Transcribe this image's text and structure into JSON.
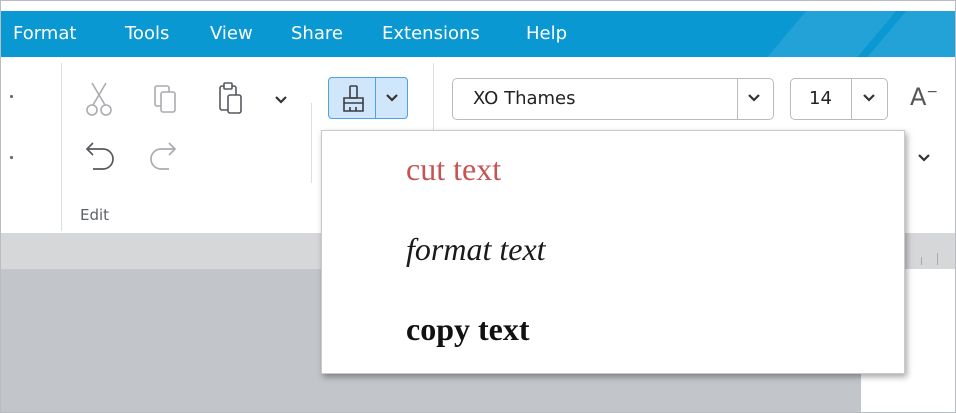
{
  "menubar": {
    "items": [
      "Format",
      "Tools",
      "View",
      "Share",
      "Extensions",
      "Help"
    ],
    "color": "#0a98d3"
  },
  "ribbon": {
    "edit_group_label": "Edit",
    "clone_formatting_active": true,
    "font_name": "XO Thames",
    "font_size": "14",
    "decrease_font_label": "A",
    "icons": [
      "cut-icon",
      "copy-icon",
      "paste-icon",
      "chevron-down-icon",
      "undo-icon",
      "redo-icon",
      "format-brush-icon"
    ]
  },
  "dropdown": {
    "items": [
      {
        "label": "cut text",
        "style": "regular",
        "color": "#c45552"
      },
      {
        "label": "format text",
        "style": "italic",
        "color": "#1a1a1a"
      },
      {
        "label": "copy text",
        "style": "bold",
        "color": "#111111"
      }
    ]
  }
}
